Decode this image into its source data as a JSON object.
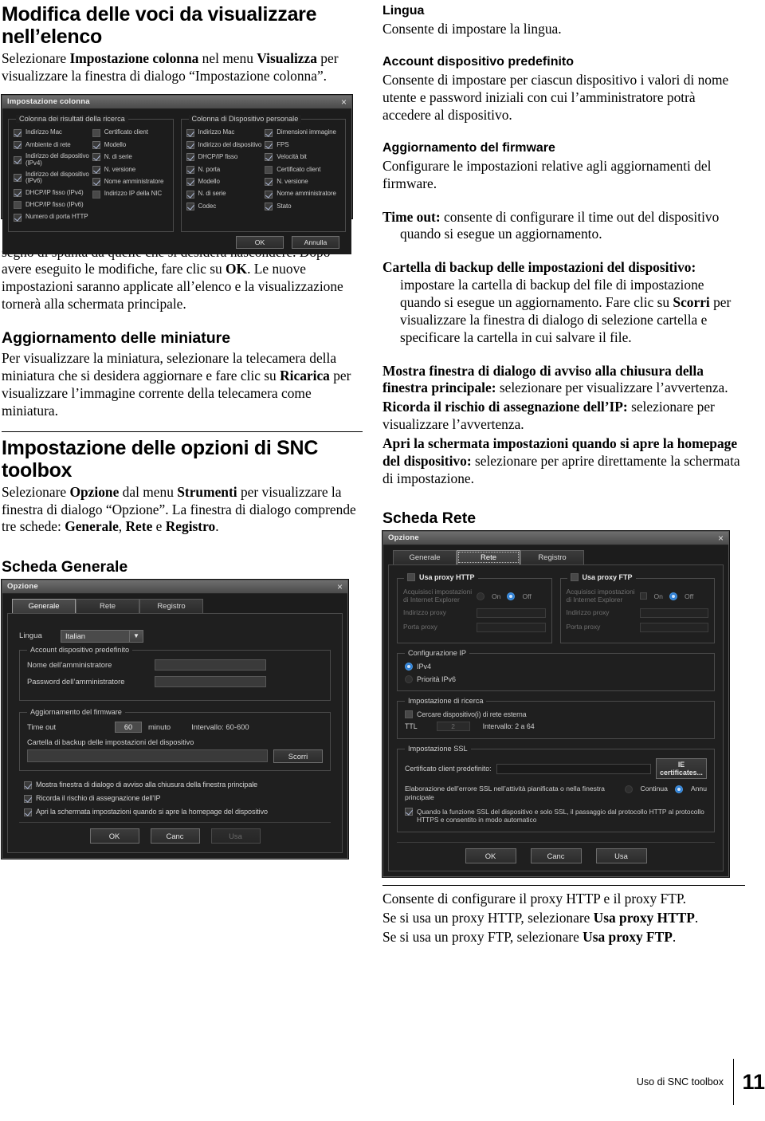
{
  "left": {
    "heading1": "Modifica delle voci da visualizzare nell’elenco",
    "para1_pre": "Selezionare ",
    "para1_b1": "Impostazione colonna",
    "para1_mid": " nel menu ",
    "para1_b2": "Visualizza",
    "para1_end": " per visualizzare la finestra di dialogo “Impostazione colonna”.",
    "para2_pre": "Selezionare le voci che si desidera visualizzare e togliere il segno di spunta da quelle che si desidera nascondere. Dopo avere eseguito le modifiche, fare clic su ",
    "para2_b": "OK",
    "para2_end": ". Le nuove impostazioni saranno applicate all’elenco e la visualizzazione tornerà alla schermata principale.",
    "heading2": "Aggiornamento delle miniature",
    "para3_pre": "Per visualizzare la miniatura, selezionare la telecamera della miniatura che si desidera aggiornare e fare clic su ",
    "para3_b": "Ricarica",
    "para3_end": " per visualizzare l’immagine corrente della telecamera come miniatura.",
    "heading3": "Impostazione delle opzioni di SNC toolbox",
    "para4_pre": "Selezionare ",
    "para4_b1": "Opzione",
    "para4_mid1": " dal menu ",
    "para4_b2": "Strumenti",
    "para4_mid2": " per visualizzare la finestra di dialogo “Opzione”. La finestra di dialogo comprende tre schede: ",
    "para4_b3": "Generale",
    "para4_mid3": ", ",
    "para4_b4": "Rete",
    "para4_mid4": " e ",
    "para4_b5": "Registro",
    "para4_end": ".",
    "heading4": "Scheda Generale"
  },
  "right": {
    "h_lingua": "Lingua",
    "p_lingua": "Consente di impostare la lingua.",
    "h_account": "Account dispositivo predefinito",
    "p_account": "Consente di impostare per ciascun dispositivo i valori di nome utente e password iniziali con cui l’amministratore potrà accedere al dispositivo.",
    "h_firmware": "Aggiornamento del firmware",
    "p_firmware": "Configurare le impostazioni relative agli aggiornamenti del firmware.",
    "timeout_b": "Time out:",
    "timeout_t": " consente di configurare il time out del dispositivo quando si esegue un aggiornamento.",
    "backup_b": "Cartella di backup delle impostazioni del dispositivo:",
    "backup_t1": " impostare la cartella di backup del file di impostazione quando si esegue un aggiornamento. Fare clic su ",
    "backup_b2": "Scorri",
    "backup_t2": " per visualizzare la finestra di dialogo di selezione cartella e specificare la cartella in cui salvare il file.",
    "mostra_b": "Mostra finestra di dialogo di avviso alla chiusura della finestra principale:",
    "mostra_t": " selezionare per visualizzare l’avvertenza.",
    "ricorda_b": "Ricorda il rischio di assegnazione dell’IP:",
    "ricorda_t": " selezionare per visualizzare l’avvertenza.",
    "apri_b": "Apri la schermata impostazioni quando si apre la homepage del dispositivo:",
    "apri_t": " selezionare per aprire direttamente la schermata di impostazione.",
    "h_scheda_rete": "Scheda Rete",
    "p_proxy1": "Consente di configurare il proxy HTTP e il proxy FTP.",
    "p_proxy2_pre": "Se si usa un proxy HTTP, selezionare ",
    "p_proxy2_b": "Usa proxy HTTP",
    "p_proxy2_end": ".",
    "p_proxy3_pre": "Se si usa un proxy FTP, selezionare ",
    "p_proxy3_b": "Usa proxy FTP",
    "p_proxy3_end": "."
  },
  "column_dialog": {
    "title": "Impostazione colonna",
    "close_icon": "×",
    "group_search": "Colonna dei risultati della ricerca",
    "group_device": "Colonna di Dispositivo personale",
    "search_col1": [
      {
        "label": "Indirizzo Mac",
        "checked": true
      },
      {
        "label": "Ambiente di rete",
        "checked": true
      },
      {
        "label": "Indirizzo del dispositivo (IPv4)",
        "checked": true
      },
      {
        "label": "Indirizzo del dispositivo (IPv6)",
        "checked": true
      },
      {
        "label": "DHCP/IP fisso (IPv4)",
        "checked": true
      },
      {
        "label": "DHCP/IP fisso (IPv6)",
        "checked": false
      },
      {
        "label": "Numero di porta HTTP",
        "checked": true
      }
    ],
    "search_col2": [
      {
        "label": "Certificato client",
        "checked": false
      },
      {
        "label": "Modello",
        "checked": true
      },
      {
        "label": "N. di serie",
        "checked": true
      },
      {
        "label": "N. versione",
        "checked": true
      },
      {
        "label": "Nome amministratore",
        "checked": true
      },
      {
        "label": "Indirizzo IP della NIC",
        "checked": false
      }
    ],
    "device_col1": [
      {
        "label": "Indirizzo Mac",
        "checked": true
      },
      {
        "label": "Indirizzo del dispositivo",
        "checked": true
      },
      {
        "label": "DHCP/IP fisso",
        "checked": true
      },
      {
        "label": "N. porta",
        "checked": true
      },
      {
        "label": "Modello",
        "checked": true
      },
      {
        "label": "N. di serie",
        "checked": true
      },
      {
        "label": "Codec",
        "checked": true
      }
    ],
    "device_col2": [
      {
        "label": "Dimensioni immagine",
        "checked": true
      },
      {
        "label": "FPS",
        "checked": true
      },
      {
        "label": "Velocità bit",
        "checked": true
      },
      {
        "label": "Certificato client",
        "checked": false
      },
      {
        "label": "N. versione",
        "checked": true
      },
      {
        "label": "Nome amministratore",
        "checked": true
      },
      {
        "label": "Stato",
        "checked": true
      }
    ],
    "ok": "OK",
    "cancel": "Annulla"
  },
  "option_general": {
    "title": "Opzione",
    "close_icon": "×",
    "tabs": [
      {
        "label": "Generale",
        "active": true
      },
      {
        "label": "Rete",
        "active": false
      },
      {
        "label": "Registro",
        "active": false
      }
    ],
    "lingua_label": "Lingua",
    "lingua_value": "Italian",
    "lingua_arrow": "▼",
    "account_legend": "Account dispositivo predefinito",
    "admin_name_label": "Nome dell’amministratore",
    "admin_name_value": "",
    "admin_pass_label": "Password dell’amministratore",
    "admin_pass_value": "",
    "fw_legend": "Aggiornamento del firmware",
    "timeout_label": "Time out",
    "timeout_value": "60",
    "timeout_unit": "minuto",
    "timeout_range": "Intervallo: 60-600",
    "backup_label": "Cartella di backup delle impostazioni del dispositivo",
    "backup_value": "",
    "browse_button": "Scorri",
    "checks": [
      {
        "label": "Mostra finestra di dialogo di avviso alla chiusura della finestra principale",
        "checked": true
      },
      {
        "label": "Ricorda il rischio di assegnazione dell’IP",
        "checked": true
      },
      {
        "label": "Apri la schermata impostazioni quando si apre la homepage del dispositivo",
        "checked": true
      }
    ],
    "ok": "OK",
    "cancel": "Canc",
    "apply": "Usa"
  },
  "option_network": {
    "title": "Opzione",
    "close_icon": "×",
    "tabs": [
      {
        "label": "Generale",
        "active": false
      },
      {
        "label": "Rete",
        "active": true
      },
      {
        "label": "Registro",
        "active": false
      }
    ],
    "http_proxy_label": "Usa proxy HTTP",
    "http_proxy_checked": false,
    "ftp_proxy_label": "Usa proxy FTP",
    "ftp_proxy_checked": false,
    "ie_settings_label": "Acquisisci impostazioni di Internet Explorer",
    "on_label": "On",
    "off_label": "Off",
    "proxy_address_label": "Indirizzo proxy",
    "proxy_port_label": "Porta proxy",
    "ip_config_legend": "Configurazione IP",
    "ipv4_label": "IPv4",
    "ipv6_label": "Priorità IPv6",
    "ip_selected": "IPv4",
    "search_legend": "Impostazione di ricerca",
    "search_external_label": "Cercare dispositivo(i) di rete esterna",
    "search_external_checked": false,
    "ttl_label": "TTL",
    "ttl_value": "2",
    "ttl_range": "Intervallo: 2 a 64",
    "ssl_legend": "Impostazione SSL",
    "ssl_cert_label": "Certificato client predefinito:",
    "ssl_cert_value": "",
    "ie_certificates_button": "IE certificates...",
    "ssl_error_label": "Elaborazione dell’errore SSL nell’attività pianificata o nella finestra principale",
    "ssl_continue": "Continua",
    "ssl_cancel": "Annu",
    "ssl_selected": "Annu",
    "ssl_auto_label": "Quando la funzione SSL del dispositivo e solo SSL, il passaggio dal protocollo HTTP al protocollo HTTPS e consentito in modo automatico",
    "ssl_auto_checked": true,
    "ok": "OK",
    "cancel": "Canc",
    "apply": "Usa"
  },
  "footer": {
    "section": "Uso di SNC toolbox",
    "page": "11"
  }
}
